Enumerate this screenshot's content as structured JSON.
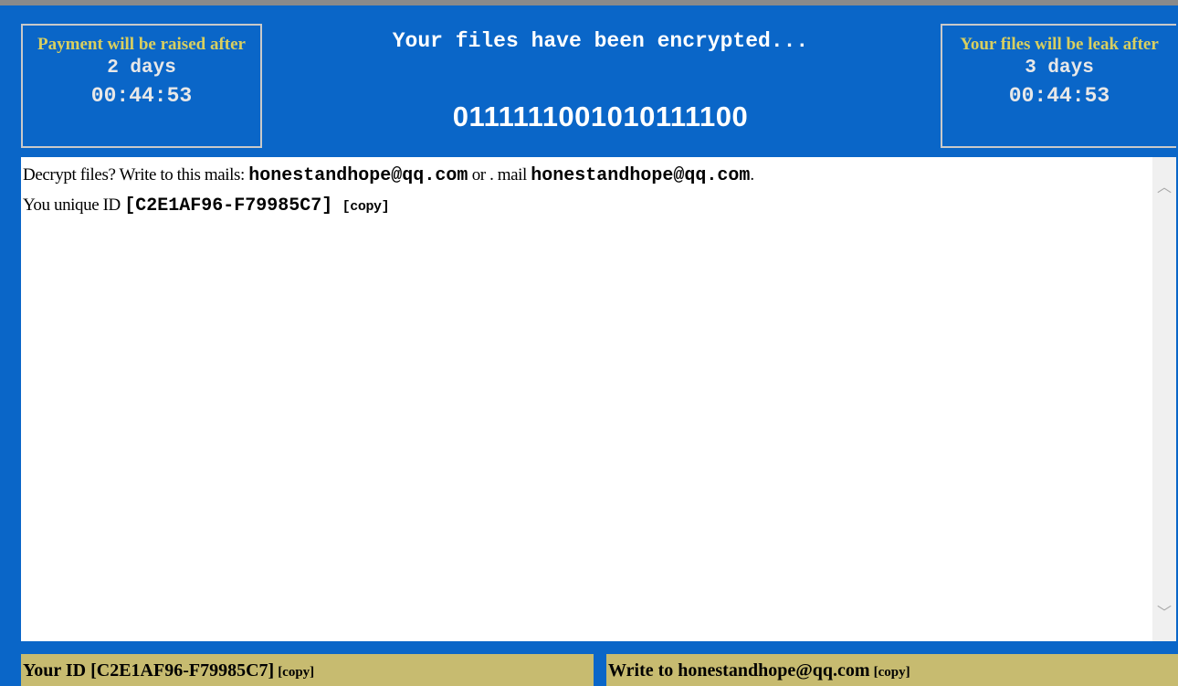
{
  "window": {
    "headline": "Your files have been encrypted...",
    "binary_code": "01111110010101111 00"
  },
  "left_timer": {
    "warning": "Payment will be raised after",
    "days": "2 days",
    "time": "00:44:53"
  },
  "right_timer": {
    "warning": "Your files will be leak after",
    "days": "3 days",
    "time": "00:44:53"
  },
  "message": {
    "line1_prefix": "Decrypt files? Write to this mails:",
    "email1": "honestandhope@qq.com",
    "line1_middle": "or . mail",
    "email2": "honestandhope@qq.com",
    "line1_suffix": ".",
    "line2_prefix": "You unique ID",
    "unique_id": "[C2E1AF96-F79985C7]",
    "copy_label": "[copy]"
  },
  "footer": {
    "left_label": "Your ID [C2E1AF96-F79985C7]",
    "left_copy": "[copy]",
    "right_label": "Write to honestandhope@qq.com",
    "right_copy": "[copy]"
  },
  "colors": {
    "background": "#0a66c8",
    "warning_text": "#d8cf60",
    "footer_bg": "#c7bb70"
  },
  "icons": [
    "scroll-up-arrow-icon",
    "scroll-down-arrow-icon"
  ]
}
